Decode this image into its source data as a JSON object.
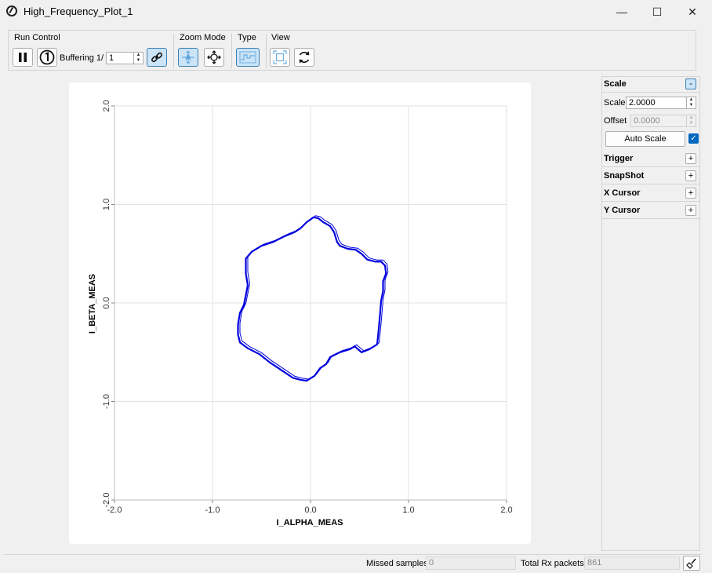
{
  "window": {
    "title": "High_Frequency_Plot_1"
  },
  "toolbar": {
    "run_control_label": "Run Control",
    "buffering_label": "Buffering 1/",
    "buffering_value": "1",
    "zoom_mode_label": "Zoom Mode",
    "type_label": "Type",
    "view_label": "View"
  },
  "right_panel": {
    "scale_header": "Scale",
    "scale_toggle": "-",
    "scale_label": "Scale",
    "scale_value": "2.0000",
    "offset_label": "Offset",
    "offset_value": "0.0000",
    "auto_scale_label": "Auto Scale",
    "auto_scale_checked": true,
    "sections": [
      {
        "label": "Trigger",
        "toggle": "+"
      },
      {
        "label": "SnapShot",
        "toggle": "+"
      },
      {
        "label": "X Cursor",
        "toggle": "+"
      },
      {
        "label": "Y Cursor",
        "toggle": "+"
      }
    ]
  },
  "status": {
    "missed_label": "Missed samples",
    "missed_value": "0",
    "total_label": "Total Rx packets",
    "total_value": "861"
  },
  "chart_data": {
    "type": "scatter",
    "xlabel": "I_ALPHA_MEAS",
    "ylabel": "I_BETA_MEAS",
    "xlim": [
      -2.0,
      2.0
    ],
    "ylim": [
      -2.0,
      2.0
    ],
    "x_ticks": [
      "-2.0",
      "-1.0",
      "0.0",
      "1.0",
      "2.0"
    ],
    "y_ticks": [
      "-2.0",
      "-1.0",
      "0.0",
      "1.0",
      "2.0"
    ],
    "grid": true,
    "series_color": "#0000dd",
    "points": [
      [
        0.03,
        0.87
      ],
      [
        0.08,
        0.86
      ],
      [
        0.13,
        0.82
      ],
      [
        0.2,
        0.78
      ],
      [
        0.24,
        0.72
      ],
      [
        0.27,
        0.62
      ],
      [
        0.3,
        0.58
      ],
      [
        0.38,
        0.55
      ],
      [
        0.46,
        0.54
      ],
      [
        0.52,
        0.5
      ],
      [
        0.58,
        0.44
      ],
      [
        0.66,
        0.42
      ],
      [
        0.72,
        0.42
      ],
      [
        0.76,
        0.38
      ],
      [
        0.77,
        0.3
      ],
      [
        0.74,
        0.22
      ],
      [
        0.74,
        0.12
      ],
      [
        0.72,
        0.02
      ],
      [
        0.71,
        -0.1
      ],
      [
        0.7,
        -0.22
      ],
      [
        0.69,
        -0.32
      ],
      [
        0.68,
        -0.42
      ],
      [
        0.6,
        -0.47
      ],
      [
        0.52,
        -0.5
      ],
      [
        0.45,
        -0.44
      ],
      [
        0.4,
        -0.47
      ],
      [
        0.3,
        -0.5
      ],
      [
        0.2,
        -0.55
      ],
      [
        0.16,
        -0.62
      ],
      [
        0.1,
        -0.66
      ],
      [
        0.04,
        -0.74
      ],
      [
        -0.04,
        -0.79
      ],
      [
        -0.1,
        -0.78
      ],
      [
        -0.18,
        -0.76
      ],
      [
        -0.3,
        -0.68
      ],
      [
        -0.42,
        -0.6
      ],
      [
        -0.52,
        -0.52
      ],
      [
        -0.64,
        -0.46
      ],
      [
        -0.72,
        -0.4
      ],
      [
        -0.74,
        -0.32
      ],
      [
        -0.74,
        -0.22
      ],
      [
        -0.72,
        -0.1
      ],
      [
        -0.68,
        -0.02
      ],
      [
        -0.66,
        0.08
      ],
      [
        -0.64,
        0.18
      ],
      [
        -0.66,
        0.3
      ],
      [
        -0.66,
        0.45
      ],
      [
        -0.6,
        0.52
      ],
      [
        -0.5,
        0.58
      ],
      [
        -0.38,
        0.62
      ],
      [
        -0.26,
        0.68
      ],
      [
        -0.16,
        0.72
      ],
      [
        -0.1,
        0.76
      ],
      [
        -0.04,
        0.82
      ],
      [
        0.03,
        0.87
      ]
    ]
  }
}
